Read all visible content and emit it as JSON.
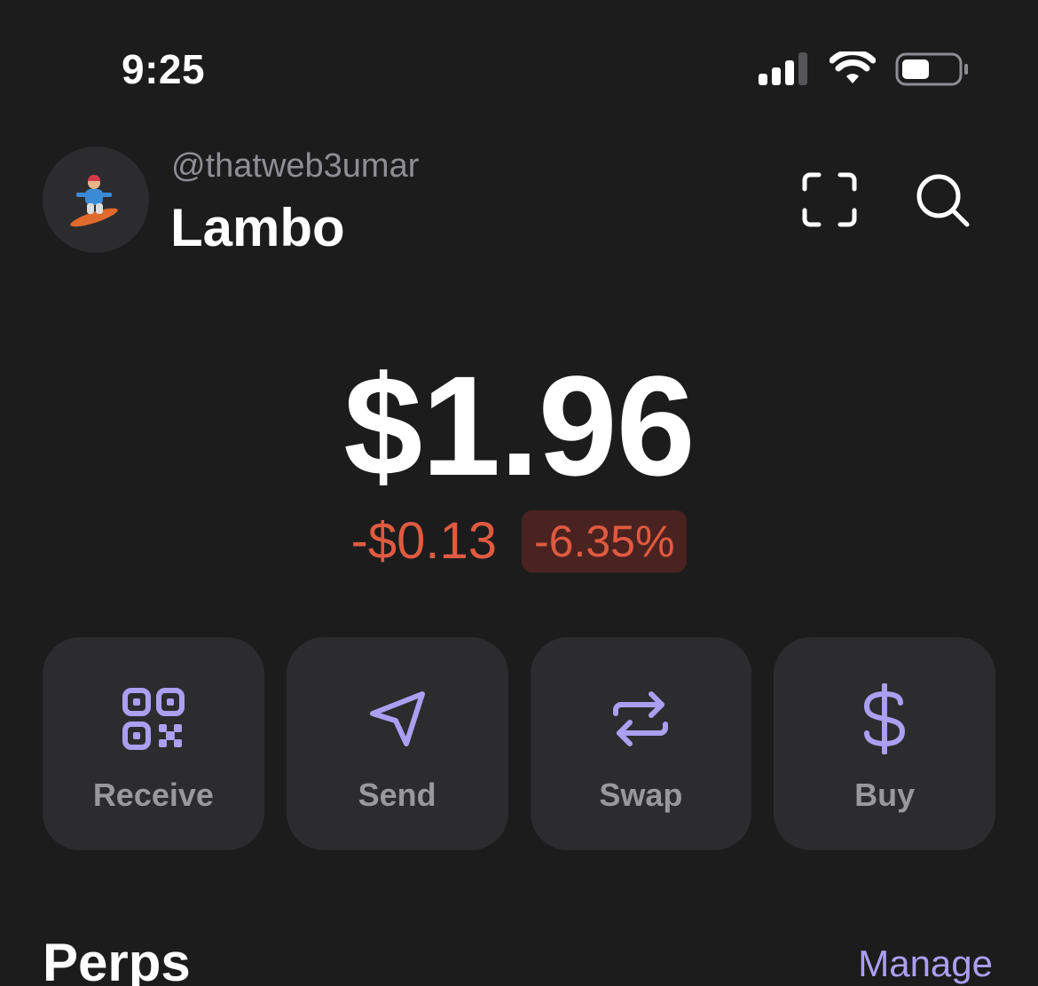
{
  "status_bar": {
    "time": "9:25",
    "icons": [
      "cellular-signal-icon",
      "wifi-icon",
      "battery-icon"
    ]
  },
  "header": {
    "avatar_icon": "snowboarder-avatar-icon",
    "handle": "@thatweb3umar",
    "account_name": "Lambo",
    "icons": [
      "scan-icon",
      "search-icon"
    ]
  },
  "balance": {
    "total": "$1.96",
    "change_amount": "-$0.13",
    "change_percent": "-6.35%"
  },
  "actions": [
    {
      "label": "Receive",
      "icon": "qr-code-icon"
    },
    {
      "label": "Send",
      "icon": "send-icon"
    },
    {
      "label": "Swap",
      "icon": "swap-icon"
    },
    {
      "label": "Buy",
      "icon": "dollar-icon"
    }
  ],
  "perps": {
    "title": "Perps",
    "manage_label": "Manage"
  },
  "colors": {
    "background": "#1c1c1d",
    "card": "#2c2c2e",
    "accent": "#ab9ff2",
    "negative": "#e05a40",
    "negative_bg": "#4a2220",
    "muted_text": "#8e8e93"
  }
}
